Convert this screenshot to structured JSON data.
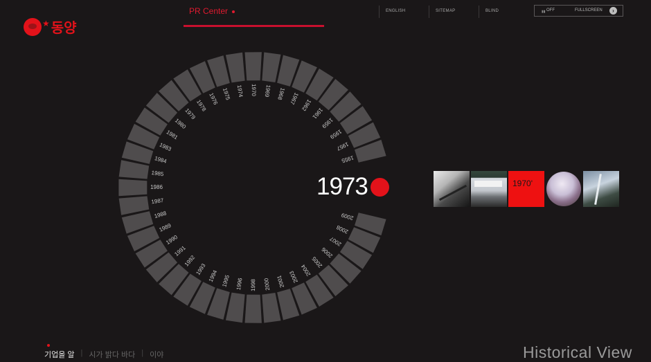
{
  "brand": {
    "name": "동양"
  },
  "nav": {
    "current_label": "PR Center"
  },
  "utility": {
    "english": "ENGLISH",
    "sitemap": "SITEMAP",
    "blind": "BLIND"
  },
  "fullscreen": {
    "state": "OFF",
    "label": "FULLSCREEN"
  },
  "timeline": {
    "selected_year": "1973",
    "years": [
      "1955",
      "1957",
      "1959",
      "1959",
      "1961",
      "1962",
      "1967",
      "1968",
      "1969",
      "1970",
      "1974",
      "1975",
      "1976",
      "1978",
      "1979",
      "1980",
      "1981",
      "1983",
      "1984",
      "1985",
      "1986",
      "1987",
      "1988",
      "1989",
      "1990",
      "1991",
      "1992",
      "1993",
      "1994",
      "1995",
      "1996",
      "1998",
      "2000",
      "2001",
      "2003",
      "2004",
      "2005",
      "2006",
      "2007",
      "2008",
      "2009"
    ]
  },
  "gallery": {
    "decade_label": "1970'"
  },
  "bottom": {
    "menu": [
      "기업을 알",
      "시가 밝다 바다",
      "이야"
    ],
    "historical_view": "Historical View"
  },
  "colors": {
    "accent": "#e3121a",
    "background": "#1a1718",
    "segment": "#4f4c4d"
  }
}
